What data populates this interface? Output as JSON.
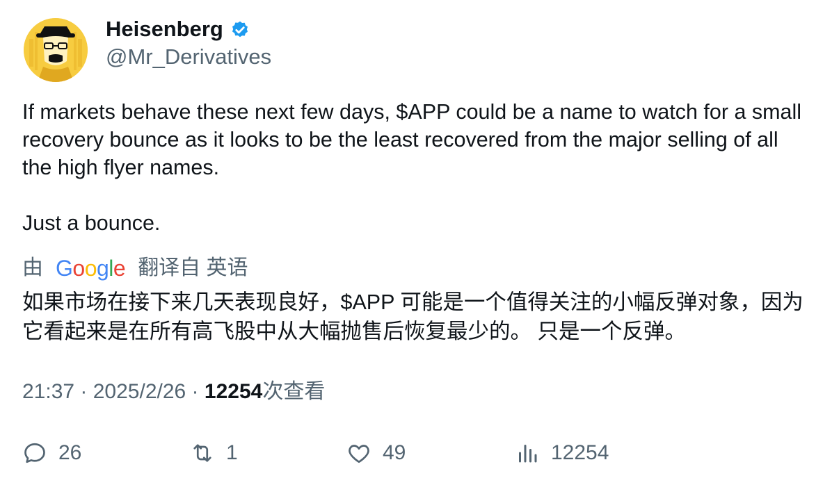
{
  "author": {
    "name": "Heisenberg",
    "handle": "@Mr_Derivatives"
  },
  "tweet": {
    "text": "If markets behave these next few days, $APP could be a name to watch for a small recovery bounce as it looks to be the least recovered from the major selling of all the high flyer names.\n\nJust a bounce."
  },
  "translation": {
    "prefix": "由",
    "provider": "Google",
    "suffix": "翻译自 英语",
    "text": "如果市场在接下来几天表现良好，$APP 可能是一个值得关注的小幅反弹对象，因为它看起来是在所有高飞股中从大幅抛售后恢复最少的。 只是一个反弹。"
  },
  "meta": {
    "time": "21:37",
    "separator1": " · ",
    "date": "2025/2/26",
    "separator2": " · ",
    "views": "12254",
    "views_label": "次查看"
  },
  "actions": {
    "replies": "26",
    "retweets": "1",
    "likes": "49",
    "views": "12254"
  },
  "colors": {
    "text": "#0f1419",
    "secondary": "#536471",
    "verified": "#1d9bf0"
  }
}
